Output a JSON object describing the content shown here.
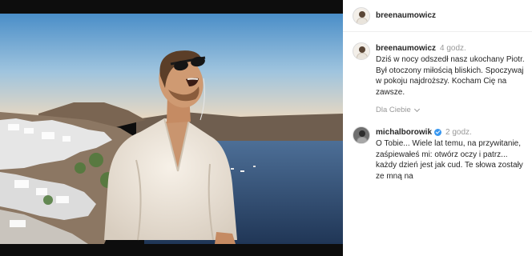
{
  "post": {
    "author": "breenaumowicz"
  },
  "caption": {
    "username": "breenaumowicz",
    "time": "4 godz.",
    "text": "Dziś w nocy odszedł nasz ukochany Piotr. Był otoczony miłością bliskich. Spoczywaj w pokoju najdroższy. Kocham Cię na zawsze.",
    "translate_label": "Dla Ciebie"
  },
  "comments": [
    {
      "username": "michalborowik",
      "verified": true,
      "time": "2 godz.",
      "text": "O Tobie... Wiele lat temu, na przywitanie, zaśpiewałeś mi: otwórz oczy i patrz... każdy dzień jest jak cud. Te słowa zostały ze mną na"
    }
  ],
  "icons": {
    "verified": "verified-badge-icon",
    "chevron": "chevron-down-icon"
  },
  "colors": {
    "verified_blue": "#3897f0",
    "muted_text": "#999999"
  }
}
